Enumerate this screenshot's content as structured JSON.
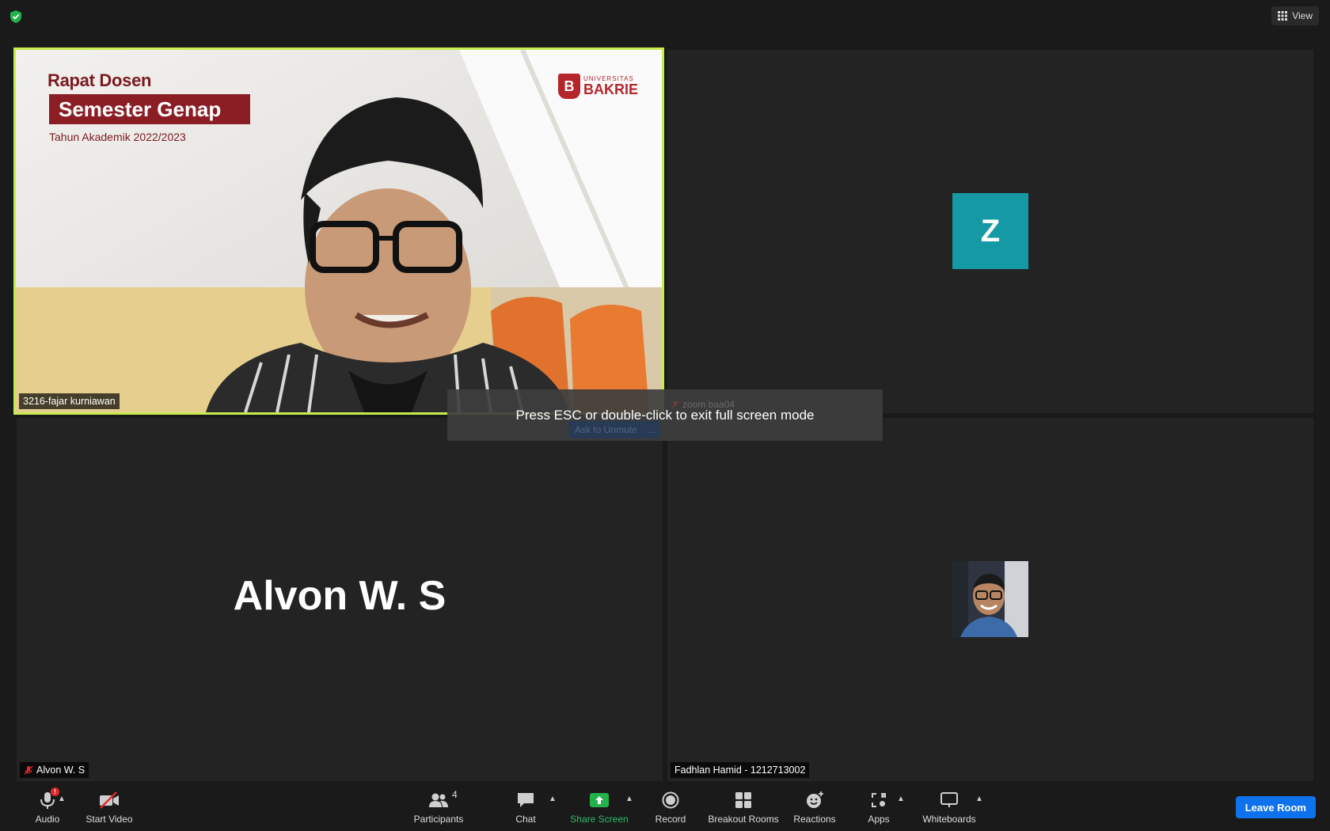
{
  "topbar": {
    "view_label": "View"
  },
  "tiles": [
    {
      "name": "3216-fajar kurniawan",
      "slide": {
        "title_line1": "Rapat Dosen",
        "title_line2": "Semester Genap",
        "subtitle": "Tahun Akademik 2022/2023",
        "logo_small": "UNIVERSITAS",
        "logo_big": "BAKRIE",
        "logo_letter": "B"
      }
    },
    {
      "name": "zoom baa04",
      "avatar_letter": "Z"
    },
    {
      "name": "Alvon W. S",
      "display_name": "Alvon W. S"
    },
    {
      "name": "Fadhlan Hamid - 1212713002"
    }
  ],
  "overlay": {
    "message": "Press ESC or double-click to exit full screen mode",
    "ask_unmute": "Ask to Unmute",
    "more": "..."
  },
  "toolbar": {
    "audio": "Audio",
    "audio_badge": "!",
    "start_video": "Start Video",
    "participants": "Participants",
    "participants_count": "4",
    "chat": "Chat",
    "share_screen": "Share Screen",
    "record": "Record",
    "breakout_rooms": "Breakout Rooms",
    "reactions": "Reactions",
    "apps": "Apps",
    "whiteboards": "Whiteboards",
    "leave": "Leave Room"
  },
  "colors": {
    "active_speaker_border": "#c6ec4f",
    "avatar_teal": "#1499a5",
    "share_green": "#2dbf6a",
    "leave_blue": "#0e72ed"
  }
}
